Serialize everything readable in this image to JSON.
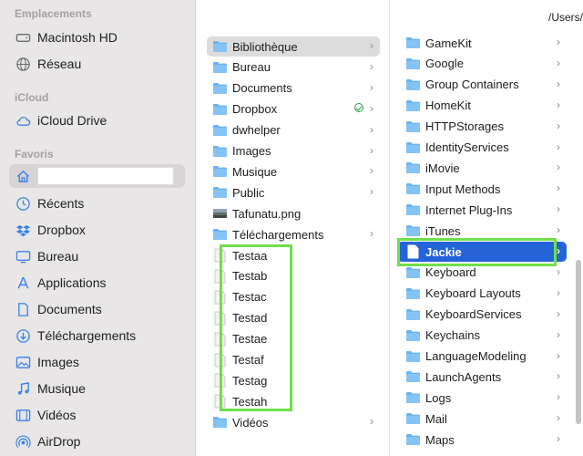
{
  "path": "/Users/",
  "sidebar": {
    "sections": [
      {
        "title": "Emplacements",
        "items": [
          {
            "label": "Macintosh HD",
            "icon": "disk-icon"
          },
          {
            "label": "Réseau",
            "icon": "globe-icon"
          }
        ]
      },
      {
        "title": "iCloud",
        "items": [
          {
            "label": "iCloud Drive",
            "icon": "cloud-icon"
          }
        ]
      },
      {
        "title": "Favoris",
        "items": [
          {
            "label": "",
            "icon": "home-icon",
            "selected": true
          },
          {
            "label": "Récents",
            "icon": "clock-icon"
          },
          {
            "label": "Dropbox",
            "icon": "dropbox-icon"
          },
          {
            "label": "Bureau",
            "icon": "desktop-icon"
          },
          {
            "label": "Applications",
            "icon": "apps-icon"
          },
          {
            "label": "Documents",
            "icon": "document-icon"
          },
          {
            "label": "Téléchargements",
            "icon": "download-icon"
          },
          {
            "label": "Images",
            "icon": "photo-icon"
          },
          {
            "label": "Musique",
            "icon": "music-icon"
          },
          {
            "label": "Vidéos",
            "icon": "film-icon"
          },
          {
            "label": "AirDrop",
            "icon": "airdrop-icon"
          }
        ]
      }
    ]
  },
  "column2": [
    {
      "label": "Bibliothèque",
      "type": "folder",
      "chevron": true,
      "highlight": true
    },
    {
      "label": "Bureau",
      "type": "folder",
      "chevron": true
    },
    {
      "label": "Documents",
      "type": "folder",
      "chevron": true
    },
    {
      "label": "Dropbox",
      "type": "folder",
      "chevron": true,
      "synced": true
    },
    {
      "label": "dwhelper",
      "type": "folder",
      "chevron": true
    },
    {
      "label": "Images",
      "type": "folder",
      "chevron": true
    },
    {
      "label": "Musique",
      "type": "folder",
      "chevron": true
    },
    {
      "label": "Public",
      "type": "folder",
      "chevron": true
    },
    {
      "label": "Tafunatu.png",
      "type": "image",
      "chevron": false
    },
    {
      "label": "Téléchargements",
      "type": "folder",
      "chevron": true
    },
    {
      "label": "Testaa",
      "type": "file",
      "chevron": false
    },
    {
      "label": "Testab",
      "type": "file",
      "chevron": false
    },
    {
      "label": "Testac",
      "type": "file",
      "chevron": false
    },
    {
      "label": "Testad",
      "type": "file",
      "chevron": false
    },
    {
      "label": "Testae",
      "type": "file",
      "chevron": false
    },
    {
      "label": "Testaf",
      "type": "file",
      "chevron": false
    },
    {
      "label": "Testag",
      "type": "file",
      "chevron": false
    },
    {
      "label": "Testah",
      "type": "file",
      "chevron": false
    },
    {
      "label": "Vidéos",
      "type": "folder",
      "chevron": true
    }
  ],
  "column3": [
    {
      "label": "GameKit",
      "type": "folder",
      "chevron": true
    },
    {
      "label": "Google",
      "type": "folder",
      "chevron": true
    },
    {
      "label": "Group Containers",
      "type": "folder",
      "chevron": true
    },
    {
      "label": "HomeKit",
      "type": "folder",
      "chevron": true
    },
    {
      "label": "HTTPStorages",
      "type": "folder",
      "chevron": true
    },
    {
      "label": "IdentityServices",
      "type": "folder",
      "chevron": true
    },
    {
      "label": "iMovie",
      "type": "folder",
      "chevron": true
    },
    {
      "label": "Input Methods",
      "type": "folder",
      "chevron": true
    },
    {
      "label": "Internet Plug-Ins",
      "type": "folder",
      "chevron": true
    },
    {
      "label": "iTunes",
      "type": "folder",
      "chevron": true
    },
    {
      "label": "Jackie",
      "type": "file",
      "chevron": true,
      "selected": true
    },
    {
      "label": "Keyboard",
      "type": "folder",
      "chevron": true
    },
    {
      "label": "Keyboard Layouts",
      "type": "folder",
      "chevron": true
    },
    {
      "label": "KeyboardServices",
      "type": "folder",
      "chevron": true
    },
    {
      "label": "Keychains",
      "type": "folder",
      "chevron": true
    },
    {
      "label": "LanguageModeling",
      "type": "folder",
      "chevron": true
    },
    {
      "label": "LaunchAgents",
      "type": "folder",
      "chevron": true
    },
    {
      "label": "Logs",
      "type": "folder",
      "chevron": true
    },
    {
      "label": "Mail",
      "type": "folder",
      "chevron": true
    },
    {
      "label": "Maps",
      "type": "folder",
      "chevron": true
    }
  ],
  "colors": {
    "accent": "#2563d8",
    "sidebar_icon": "#3b82e8",
    "folder": "#6cb4f0",
    "annotation": "#6fe04a"
  }
}
